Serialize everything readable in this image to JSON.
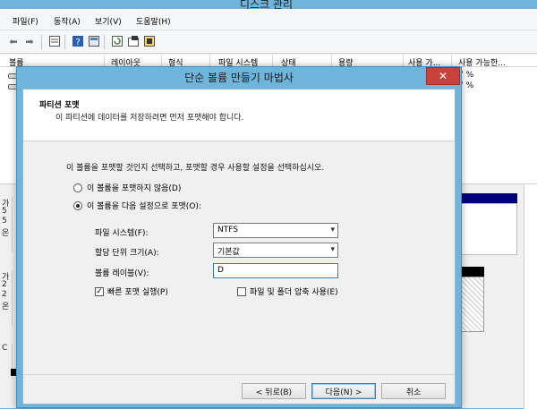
{
  "window": {
    "title": "디스크 관리"
  },
  "menu": [
    "파일(F)",
    "동작(A)",
    "보기(V)",
    "도움말(H)"
  ],
  "toolbar_icons": [
    "back-arrow-icon",
    "forward-arrow-icon",
    "list-view-icon",
    "help-icon",
    "properties-icon",
    "refresh-icon",
    "settings-icon",
    "console-icon"
  ],
  "columns": [
    "볼륨",
    "레이아웃",
    "형식",
    "파일 시스템",
    "상태",
    "용량",
    "사용 가...",
    "사용 가능한..."
  ],
  "volumes": [
    {
      "percent": "7 %"
    },
    {
      "percent": "7 %"
    }
  ],
  "disk_labels": [
    [
      "가",
      "5",
      "5",
      "온"
    ],
    [
      "가",
      "2",
      "2",
      "온"
    ],
    [
      "C"
    ]
  ],
  "dialog": {
    "title": "단순 볼륨 만들기 마법사",
    "close": "✕",
    "header_title": "파티션 포맷",
    "header_subtitle": "이 파티션에 데이터를 저장하려면 먼저 포맷해야 합니다.",
    "instruction": "이 볼륨을 포맷할 것인지 선택하고, 포맷할 경우 사용할 설정을 선택하십시오.",
    "radio_no_format": "이 볼륨을 포맷하지 않음(D)",
    "radio_format": "이 볼륨을 다음 설정으로 포맷(O):",
    "filesystem_label": "파일 시스템(F):",
    "filesystem_value": "NTFS",
    "alloc_label": "할당 단위 크기(A):",
    "alloc_value": "기본값",
    "volume_label_label": "볼륨 레이블(V):",
    "volume_label_value": "D",
    "quick_format": "빠른 포맷 실행(P)",
    "compression": "파일 및 폴더 압축 사용(E)",
    "back": "< 뒤로(B)",
    "next": "다음(N) >",
    "cancel": "취소"
  }
}
